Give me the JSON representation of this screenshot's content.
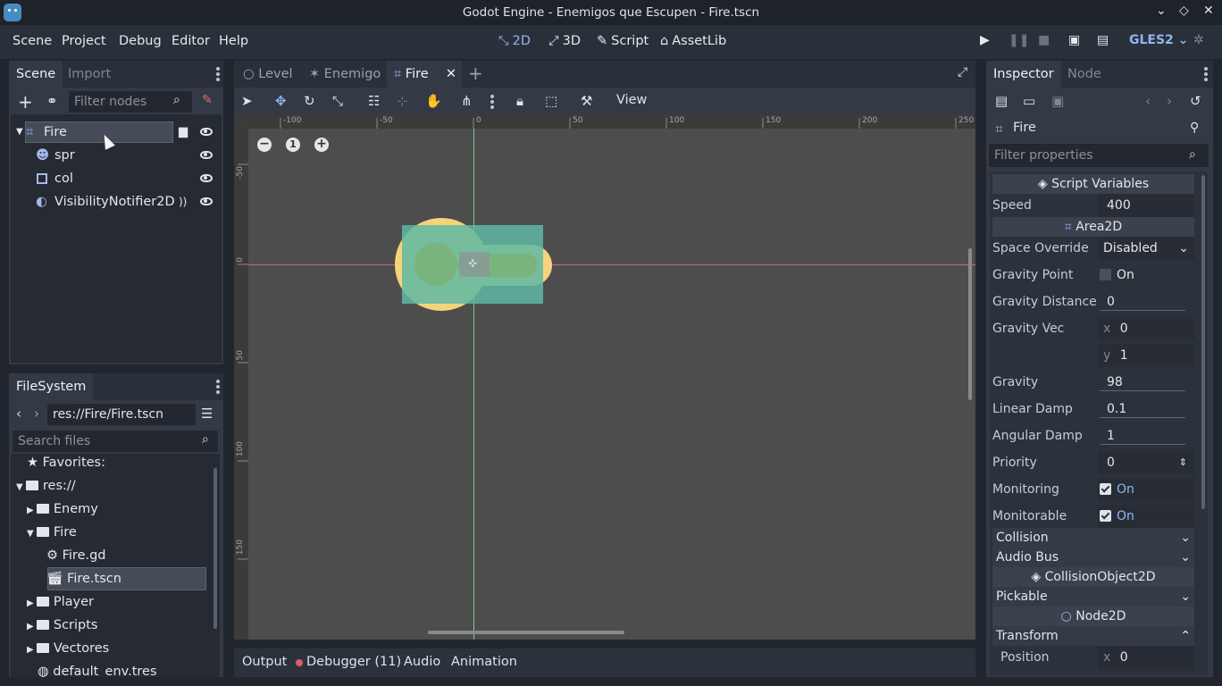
{
  "window": {
    "title": "Godot Engine - Enemigos que Escupen - Fire.tscn"
  },
  "menu": [
    "Scene",
    "Project",
    "Debug",
    "Editor",
    "Help"
  ],
  "modes": [
    {
      "label": "2D",
      "active": true
    },
    {
      "label": "3D"
    },
    {
      "label": "Script"
    },
    {
      "label": "AssetLib"
    }
  ],
  "renderer": "GLES2",
  "scene_panel": {
    "tabs": [
      "Scene",
      "Import"
    ],
    "filter_placeholder": "Filter nodes",
    "nodes": [
      {
        "label": "Fire",
        "level": 0,
        "selected": true
      },
      {
        "label": "spr",
        "level": 1
      },
      {
        "label": "col",
        "level": 1
      },
      {
        "label": "VisibilityNotifier2D",
        "level": 1
      }
    ]
  },
  "filesystem": {
    "tab": "FileSystem",
    "path": "res://Fire/Fire.tscn",
    "search_placeholder": "Search files",
    "items": [
      {
        "label": "Favorites:",
        "level": 0
      },
      {
        "label": "res://",
        "level": 0
      },
      {
        "label": "Enemy",
        "level": 1
      },
      {
        "label": "Fire",
        "level": 1
      },
      {
        "label": "Fire.gd",
        "level": 2
      },
      {
        "label": "Fire.tscn",
        "level": 2,
        "selected": true
      },
      {
        "label": "Player",
        "level": 1
      },
      {
        "label": "Scripts",
        "level": 1
      },
      {
        "label": "Vectores",
        "level": 1
      },
      {
        "label": "default_env.tres",
        "level": 1
      }
    ]
  },
  "editor_tabs": [
    {
      "label": "Level"
    },
    {
      "label": "Enemigo"
    },
    {
      "label": "Fire",
      "active": true
    }
  ],
  "toolbar": {
    "view_label": "View"
  },
  "ruler": {
    "h_labels": [
      "-100",
      "-50",
      "0",
      "50",
      "100",
      "150",
      "200",
      "250"
    ],
    "v_labels": [
      "-50",
      "0",
      "50",
      "100",
      "150"
    ]
  },
  "zoom": {
    "reset_label": "1"
  },
  "bottom_tabs": [
    "Output",
    "Debugger (11)",
    "Audio",
    "Animation"
  ],
  "inspector": {
    "tabs": [
      "Inspector",
      "Node"
    ],
    "object": "Fire",
    "filter_placeholder": "Filter properties",
    "sections": {
      "script": "Script Variables",
      "area": "Area2D",
      "collision_object": "CollisionObject2D",
      "node2d": "Node2D"
    },
    "props": {
      "speed": {
        "label": "Speed",
        "value": "400"
      },
      "space_override": {
        "label": "Space Override",
        "value": "Disabled"
      },
      "gravity_point": {
        "label": "Gravity Point",
        "value": "On"
      },
      "gravity_distance": {
        "label": "Gravity Distance",
        "value": "0"
      },
      "gravity_vec": {
        "label": "Gravity Vec",
        "x": "0",
        "y": "1"
      },
      "gravity": {
        "label": "Gravity",
        "value": "98"
      },
      "linear_damp": {
        "label": "Linear Damp",
        "value": "0.1"
      },
      "angular_damp": {
        "label": "Angular Damp",
        "value": "1"
      },
      "priority": {
        "label": "Priority",
        "value": "0"
      },
      "monitoring": {
        "label": "Monitoring",
        "value": "On"
      },
      "monitorable": {
        "label": "Monitorable",
        "value": "On"
      }
    },
    "groups": {
      "collision": "Collision",
      "audio_bus": "Audio Bus",
      "pickable": "Pickable",
      "transform": "Transform"
    },
    "position": {
      "label": "Position",
      "x": "0"
    }
  },
  "colors": {
    "accent": "#8eb6f2",
    "panel": "#2c323c",
    "viewport": "#4d4d4d",
    "sprite": "#f5d37a",
    "shape": "#5fb9a3"
  }
}
